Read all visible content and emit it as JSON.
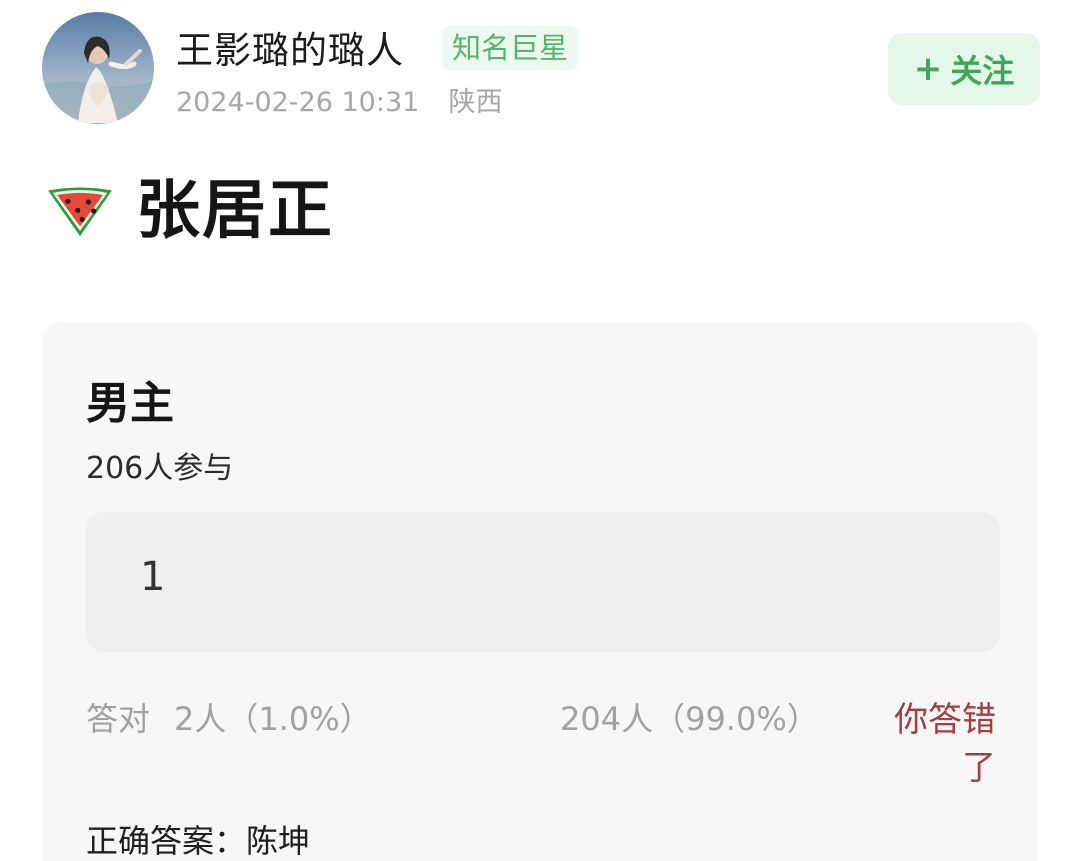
{
  "header": {
    "author_name": "王影璐的璐人",
    "badge": "知名巨星",
    "datetime": "2024-02-26 10:31",
    "location": "陕西",
    "follow_icon": "+",
    "follow_label": "关注"
  },
  "post": {
    "title_icon": "watermelon-icon",
    "title": "张居正"
  },
  "quiz": {
    "question": "男主",
    "participants": "206人参与",
    "answer": "1",
    "correct_label": "答对",
    "correct_count": "2人（1.0%）",
    "wrong_count": "204人（99.0%）",
    "result": "你答错了",
    "correct_answer": "正确答案：陈坤"
  },
  "colors": {
    "badge_green": "#58b46c",
    "follow_green": "#3da658",
    "wrong_red": "#a83d3d",
    "meta_gray": "#a7a7a7"
  }
}
